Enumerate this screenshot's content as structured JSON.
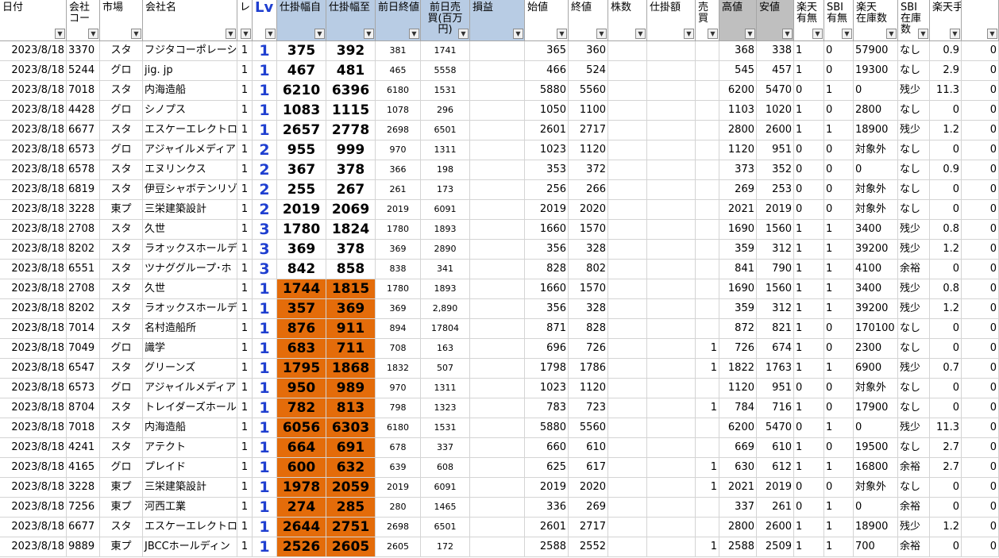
{
  "headers": [
    {
      "key": "date",
      "label": "日付"
    },
    {
      "key": "code",
      "label": "会社\nコー"
    },
    {
      "key": "market",
      "label": "市場"
    },
    {
      "key": "name",
      "label": "会社名"
    },
    {
      "key": "re",
      "label": "レ"
    },
    {
      "key": "lv",
      "label": "Lv"
    },
    {
      "key": "from",
      "label": "仕掛幅自"
    },
    {
      "key": "to",
      "label": "仕掛幅至"
    },
    {
      "key": "prev_close",
      "label": "前日終値"
    },
    {
      "key": "prev_vol",
      "label": "前日売\n買(百万\n円)"
    },
    {
      "key": "pl",
      "label": "損益"
    },
    {
      "key": "open",
      "label": "始値"
    },
    {
      "key": "close",
      "label": "終値"
    },
    {
      "key": "shares",
      "label": "株数"
    },
    {
      "key": "amount",
      "label": "仕掛額"
    },
    {
      "key": "sell",
      "label": "売\n買"
    },
    {
      "key": "high",
      "label": "高値"
    },
    {
      "key": "low",
      "label": "安値"
    },
    {
      "key": "rakuten_flag",
      "label": "楽天\n有無"
    },
    {
      "key": "sbi_flag",
      "label": "SBI\n有無"
    },
    {
      "key": "rakuten_stock",
      "label": "楽天\n在庫数"
    },
    {
      "key": "sbi_stock",
      "label": "SBI\n在庫\n数"
    },
    {
      "key": "fee",
      "label": "楽天手数料"
    },
    {
      "key": "extra",
      "label": ""
    }
  ],
  "rows": [
    {
      "date": "2023/8/18",
      "code": "3370",
      "market": "スタ",
      "name": "フジタコーポレーシ",
      "re": "1",
      "lv": "1",
      "from": "375",
      "to": "392",
      "prev_close": "381",
      "prev_vol": "1741",
      "pl": "",
      "open": "365",
      "close": "360",
      "shares": "",
      "amount": "",
      "sell": "",
      "high": "368",
      "low": "338",
      "rakuten_flag": "1",
      "sbi_flag": "0",
      "rakuten_stock": "57900",
      "sbi_stock": "なし",
      "fee": "0.9",
      "extra": "0",
      "hl": false
    },
    {
      "date": "2023/8/18",
      "code": "5244",
      "market": "グロ",
      "name": "jig. jp",
      "re": "1",
      "lv": "1",
      "from": "467",
      "to": "481",
      "prev_close": "465",
      "prev_vol": "5558",
      "pl": "",
      "open": "466",
      "close": "524",
      "shares": "",
      "amount": "",
      "sell": "",
      "high": "545",
      "low": "457",
      "rakuten_flag": "1",
      "sbi_flag": "0",
      "rakuten_stock": "19300",
      "sbi_stock": "なし",
      "fee": "2.9",
      "extra": "0",
      "hl": false
    },
    {
      "date": "2023/8/18",
      "code": "7018",
      "market": "スタ",
      "name": "内海造船",
      "re": "1",
      "lv": "1",
      "from": "6210",
      "to": "6396",
      "prev_close": "6180",
      "prev_vol": "1531",
      "pl": "",
      "open": "5880",
      "close": "5560",
      "shares": "",
      "amount": "",
      "sell": "",
      "high": "6200",
      "low": "5470",
      "rakuten_flag": "0",
      "sbi_flag": "1",
      "rakuten_stock": "0",
      "sbi_stock": "残少",
      "fee": "11.3",
      "extra": "0",
      "hl": false
    },
    {
      "date": "2023/8/18",
      "code": "4428",
      "market": "グロ",
      "name": "シノプス",
      "re": "1",
      "lv": "1",
      "from": "1083",
      "to": "1115",
      "prev_close": "1078",
      "prev_vol": "296",
      "pl": "",
      "open": "1050",
      "close": "1100",
      "shares": "",
      "amount": "",
      "sell": "",
      "high": "1103",
      "low": "1020",
      "rakuten_flag": "1",
      "sbi_flag": "0",
      "rakuten_stock": "2800",
      "sbi_stock": "なし",
      "fee": "0",
      "extra": "0",
      "hl": false
    },
    {
      "date": "2023/8/18",
      "code": "6677",
      "market": "スタ",
      "name": "エスケーエレクトロ",
      "re": "1",
      "lv": "1",
      "from": "2657",
      "to": "2778",
      "prev_close": "2698",
      "prev_vol": "6501",
      "pl": "",
      "open": "2601",
      "close": "2717",
      "shares": "",
      "amount": "",
      "sell": "",
      "high": "2800",
      "low": "2600",
      "rakuten_flag": "1",
      "sbi_flag": "1",
      "rakuten_stock": "18900",
      "sbi_stock": "残少",
      "fee": "1.2",
      "extra": "0",
      "hl": false
    },
    {
      "date": "2023/8/18",
      "code": "6573",
      "market": "グロ",
      "name": "アジャイルメディア",
      "re": "1",
      "lv": "2",
      "from": "955",
      "to": "999",
      "prev_close": "970",
      "prev_vol": "1311",
      "pl": "",
      "open": "1023",
      "close": "1120",
      "shares": "",
      "amount": "",
      "sell": "",
      "high": "1120",
      "low": "951",
      "rakuten_flag": "0",
      "sbi_flag": "0",
      "rakuten_stock": "対象外",
      "sbi_stock": "なし",
      "fee": "0",
      "extra": "0",
      "hl": false
    },
    {
      "date": "2023/8/18",
      "code": "6578",
      "market": "スタ",
      "name": "エヌリンクス",
      "re": "1",
      "lv": "2",
      "from": "367",
      "to": "378",
      "prev_close": "366",
      "prev_vol": "198",
      "pl": "",
      "open": "353",
      "close": "372",
      "shares": "",
      "amount": "",
      "sell": "",
      "high": "373",
      "low": "352",
      "rakuten_flag": "0",
      "sbi_flag": "0",
      "rakuten_stock": "0",
      "sbi_stock": "なし",
      "fee": "0.9",
      "extra": "0",
      "hl": false
    },
    {
      "date": "2023/8/18",
      "code": "6819",
      "market": "スタ",
      "name": "伊豆シャボテンリゾ",
      "re": "1",
      "lv": "2",
      "from": "255",
      "to": "267",
      "prev_close": "261",
      "prev_vol": "173",
      "pl": "",
      "open": "256",
      "close": "266",
      "shares": "",
      "amount": "",
      "sell": "",
      "high": "269",
      "low": "253",
      "rakuten_flag": "0",
      "sbi_flag": "0",
      "rakuten_stock": "対象外",
      "sbi_stock": "なし",
      "fee": "0",
      "extra": "0",
      "hl": false
    },
    {
      "date": "2023/8/18",
      "code": "3228",
      "market": "東プ",
      "name": "三栄建築設計",
      "re": "1",
      "lv": "2",
      "from": "2019",
      "to": "2069",
      "prev_close": "2019",
      "prev_vol": "6091",
      "pl": "",
      "open": "2019",
      "close": "2020",
      "shares": "",
      "amount": "",
      "sell": "",
      "high": "2021",
      "low": "2019",
      "rakuten_flag": "0",
      "sbi_flag": "0",
      "rakuten_stock": "対象外",
      "sbi_stock": "なし",
      "fee": "0",
      "extra": "0",
      "hl": false
    },
    {
      "date": "2023/8/18",
      "code": "2708",
      "market": "スタ",
      "name": "久世",
      "re": "1",
      "lv": "3",
      "from": "1780",
      "to": "1824",
      "prev_close": "1780",
      "prev_vol": "1893",
      "pl": "",
      "open": "1660",
      "close": "1570",
      "shares": "",
      "amount": "",
      "sell": "",
      "high": "1690",
      "low": "1560",
      "rakuten_flag": "1",
      "sbi_flag": "1",
      "rakuten_stock": "3400",
      "sbi_stock": "残少",
      "fee": "0.8",
      "extra": "0",
      "hl": false
    },
    {
      "date": "2023/8/18",
      "code": "8202",
      "market": "スタ",
      "name": "ラオックスホールデ",
      "re": "1",
      "lv": "3",
      "from": "369",
      "to": "378",
      "prev_close": "369",
      "prev_vol": "2890",
      "pl": "",
      "open": "356",
      "close": "328",
      "shares": "",
      "amount": "",
      "sell": "",
      "high": "359",
      "low": "312",
      "rakuten_flag": "1",
      "sbi_flag": "1",
      "rakuten_stock": "39200",
      "sbi_stock": "残少",
      "fee": "1.2",
      "extra": "0",
      "hl": false
    },
    {
      "date": "2023/8/18",
      "code": "6551",
      "market": "スタ",
      "name": "ツナググループ･ホ",
      "re": "1",
      "lv": "3",
      "from": "842",
      "to": "858",
      "prev_close": "838",
      "prev_vol": "341",
      "pl": "",
      "open": "828",
      "close": "802",
      "shares": "",
      "amount": "",
      "sell": "",
      "high": "841",
      "low": "790",
      "rakuten_flag": "1",
      "sbi_flag": "1",
      "rakuten_stock": "4100",
      "sbi_stock": "余裕",
      "fee": "0",
      "extra": "0",
      "hl": false
    },
    {
      "date": "2023/8/18",
      "code": "2708",
      "market": "スタ",
      "name": "久世",
      "re": "1",
      "lv": "1",
      "from": "1744",
      "to": "1815",
      "prev_close": "1780",
      "prev_vol": "1893",
      "pl": "",
      "open": "1660",
      "close": "1570",
      "shares": "",
      "amount": "",
      "sell": "",
      "high": "1690",
      "low": "1560",
      "rakuten_flag": "1",
      "sbi_flag": "1",
      "rakuten_stock": "3400",
      "sbi_stock": "残少",
      "fee": "0.8",
      "extra": "0",
      "hl": true
    },
    {
      "date": "2023/8/18",
      "code": "8202",
      "market": "スタ",
      "name": "ラオックスホールデ",
      "re": "1",
      "lv": "1",
      "from": "357",
      "to": "369",
      "prev_close": "369",
      "prev_vol": "2,890",
      "pl": "",
      "open": "356",
      "close": "328",
      "shares": "",
      "amount": "",
      "sell": "",
      "high": "359",
      "low": "312",
      "rakuten_flag": "1",
      "sbi_flag": "1",
      "rakuten_stock": "39200",
      "sbi_stock": "残少",
      "fee": "1.2",
      "extra": "0",
      "hl": true
    },
    {
      "date": "2023/8/18",
      "code": "7014",
      "market": "スタ",
      "name": "名村造船所",
      "re": "1",
      "lv": "1",
      "from": "876",
      "to": "911",
      "prev_close": "894",
      "prev_vol": "17804",
      "pl": "",
      "open": "871",
      "close": "828",
      "shares": "",
      "amount": "",
      "sell": "",
      "high": "872",
      "low": "821",
      "rakuten_flag": "1",
      "sbi_flag": "0",
      "rakuten_stock": "170100",
      "sbi_stock": "なし",
      "fee": "0",
      "extra": "0",
      "hl": true
    },
    {
      "date": "2023/8/18",
      "code": "7049",
      "market": "グロ",
      "name": "識学",
      "re": "1",
      "lv": "1",
      "from": "683",
      "to": "711",
      "prev_close": "708",
      "prev_vol": "163",
      "pl": "",
      "open": "696",
      "close": "726",
      "shares": "",
      "amount": "",
      "sell": "1",
      "high": "726",
      "low": "674",
      "rakuten_flag": "1",
      "sbi_flag": "0",
      "rakuten_stock": "2300",
      "sbi_stock": "なし",
      "fee": "0",
      "extra": "0",
      "hl": true
    },
    {
      "date": "2023/8/18",
      "code": "6547",
      "market": "スタ",
      "name": "グリーンズ",
      "re": "1",
      "lv": "1",
      "from": "1795",
      "to": "1868",
      "prev_close": "1832",
      "prev_vol": "507",
      "pl": "",
      "open": "1798",
      "close": "1786",
      "shares": "",
      "amount": "",
      "sell": "1",
      "high": "1822",
      "low": "1763",
      "rakuten_flag": "1",
      "sbi_flag": "1",
      "rakuten_stock": "6900",
      "sbi_stock": "残少",
      "fee": "0.7",
      "extra": "0",
      "hl": true
    },
    {
      "date": "2023/8/18",
      "code": "6573",
      "market": "グロ",
      "name": "アジャイルメディア･",
      "re": "1",
      "lv": "1",
      "from": "950",
      "to": "989",
      "prev_close": "970",
      "prev_vol": "1311",
      "pl": "",
      "open": "1023",
      "close": "1120",
      "shares": "",
      "amount": "",
      "sell": "",
      "high": "1120",
      "low": "951",
      "rakuten_flag": "0",
      "sbi_flag": "0",
      "rakuten_stock": "対象外",
      "sbi_stock": "なし",
      "fee": "0",
      "extra": "0",
      "hl": true
    },
    {
      "date": "2023/8/18",
      "code": "8704",
      "market": "スタ",
      "name": "トレイダーズホール",
      "re": "1",
      "lv": "1",
      "from": "782",
      "to": "813",
      "prev_close": "798",
      "prev_vol": "1323",
      "pl": "",
      "open": "783",
      "close": "723",
      "shares": "",
      "amount": "",
      "sell": "1",
      "high": "784",
      "low": "716",
      "rakuten_flag": "1",
      "sbi_flag": "0",
      "rakuten_stock": "17900",
      "sbi_stock": "なし",
      "fee": "0",
      "extra": "0",
      "hl": true
    },
    {
      "date": "2023/8/18",
      "code": "7018",
      "market": "スタ",
      "name": "内海造船",
      "re": "1",
      "lv": "1",
      "from": "6056",
      "to": "6303",
      "prev_close": "6180",
      "prev_vol": "1531",
      "pl": "",
      "open": "5880",
      "close": "5560",
      "shares": "",
      "amount": "",
      "sell": "",
      "high": "6200",
      "low": "5470",
      "rakuten_flag": "0",
      "sbi_flag": "1",
      "rakuten_stock": "0",
      "sbi_stock": "残少",
      "fee": "11.3",
      "extra": "0",
      "hl": true
    },
    {
      "date": "2023/8/18",
      "code": "4241",
      "market": "スタ",
      "name": "アテクト",
      "re": "1",
      "lv": "1",
      "from": "664",
      "to": "691",
      "prev_close": "678",
      "prev_vol": "337",
      "pl": "",
      "open": "660",
      "close": "610",
      "shares": "",
      "amount": "",
      "sell": "",
      "high": "669",
      "low": "610",
      "rakuten_flag": "1",
      "sbi_flag": "0",
      "rakuten_stock": "19500",
      "sbi_stock": "なし",
      "fee": "2.7",
      "extra": "0",
      "hl": true
    },
    {
      "date": "2023/8/18",
      "code": "4165",
      "market": "グロ",
      "name": "プレイド",
      "re": "1",
      "lv": "1",
      "from": "600",
      "to": "632",
      "prev_close": "639",
      "prev_vol": "608",
      "pl": "",
      "open": "625",
      "close": "617",
      "shares": "",
      "amount": "",
      "sell": "1",
      "high": "630",
      "low": "612",
      "rakuten_flag": "1",
      "sbi_flag": "1",
      "rakuten_stock": "16800",
      "sbi_stock": "余裕",
      "fee": "2.7",
      "extra": "0",
      "hl": true
    },
    {
      "date": "2023/8/18",
      "code": "3228",
      "market": "東プ",
      "name": "三栄建築設計",
      "re": "1",
      "lv": "1",
      "from": "1978",
      "to": "2059",
      "prev_close": "2019",
      "prev_vol": "6091",
      "pl": "",
      "open": "2019",
      "close": "2020",
      "shares": "",
      "amount": "",
      "sell": "1",
      "high": "2021",
      "low": "2019",
      "rakuten_flag": "0",
      "sbi_flag": "0",
      "rakuten_stock": "対象外",
      "sbi_stock": "なし",
      "fee": "0",
      "extra": "0",
      "hl": true
    },
    {
      "date": "2023/8/18",
      "code": "7256",
      "market": "東プ",
      "name": "河西工業",
      "re": "1",
      "lv": "1",
      "from": "274",
      "to": "285",
      "prev_close": "280",
      "prev_vol": "1465",
      "pl": "",
      "open": "336",
      "close": "269",
      "shares": "",
      "amount": "",
      "sell": "",
      "high": "337",
      "low": "261",
      "rakuten_flag": "0",
      "sbi_flag": "1",
      "rakuten_stock": "0",
      "sbi_stock": "余裕",
      "fee": "0",
      "extra": "0",
      "hl": true
    },
    {
      "date": "2023/8/18",
      "code": "6677",
      "market": "スタ",
      "name": "エスケーエレクトロ",
      "re": "1",
      "lv": "1",
      "from": "2644",
      "to": "2751",
      "prev_close": "2698",
      "prev_vol": "6501",
      "pl": "",
      "open": "2601",
      "close": "2717",
      "shares": "",
      "amount": "",
      "sell": "",
      "high": "2800",
      "low": "2600",
      "rakuten_flag": "1",
      "sbi_flag": "1",
      "rakuten_stock": "18900",
      "sbi_stock": "残少",
      "fee": "1.2",
      "extra": "0",
      "hl": true
    },
    {
      "date": "2023/8/18",
      "code": "9889",
      "market": "東プ",
      "name": "JBCCホールディン",
      "re": "1",
      "lv": "1",
      "from": "2526",
      "to": "2605",
      "prev_close": "2605",
      "prev_vol": "172",
      "pl": "",
      "open": "2588",
      "close": "2552",
      "shares": "",
      "amount": "",
      "sell": "1",
      "high": "2588",
      "low": "2509",
      "rakuten_flag": "1",
      "sbi_flag": "1",
      "rakuten_stock": "700",
      "sbi_stock": "余裕",
      "fee": "0",
      "extra": "0",
      "hl": true
    }
  ]
}
